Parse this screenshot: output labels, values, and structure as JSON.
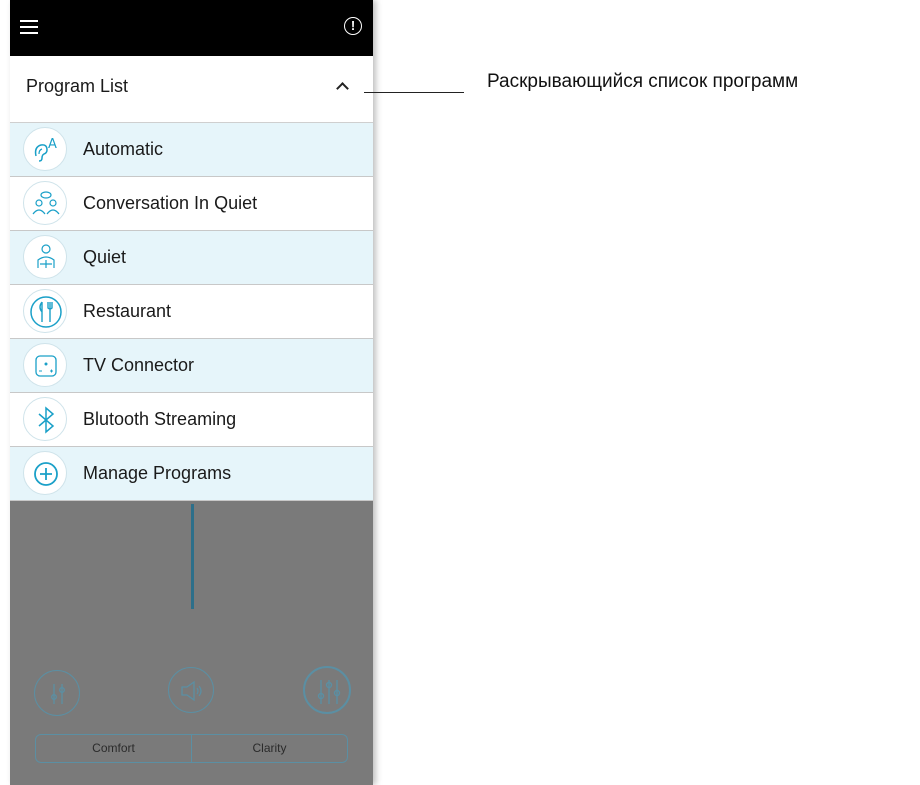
{
  "header": {
    "program_list_label": "Program List"
  },
  "programs": [
    {
      "label": "Automatic",
      "icon": "automatic-ear-icon",
      "tinted": true
    },
    {
      "label": "Conversation In Quiet",
      "icon": "conversation-icon",
      "tinted": false
    },
    {
      "label": "Quiet",
      "icon": "reading-person-icon",
      "tinted": true
    },
    {
      "label": "Restaurant",
      "icon": "restaurant-icon",
      "tinted": false
    },
    {
      "label": "TV Connector",
      "icon": "tv-connector-icon",
      "tinted": true
    },
    {
      "label": "Blutooth Streaming",
      "icon": "bluetooth-icon",
      "tinted": false
    },
    {
      "label": "Manage Programs",
      "icon": "plus-circle-icon",
      "tinted": true
    }
  ],
  "segment": {
    "left": "Comfort",
    "right": "Clarity"
  },
  "callout": {
    "text": "Раскрывающийся список программ"
  },
  "colors": {
    "accent": "#1aa0c8",
    "tint": "#e6f5fa",
    "overlay": "#7a7a7a"
  }
}
